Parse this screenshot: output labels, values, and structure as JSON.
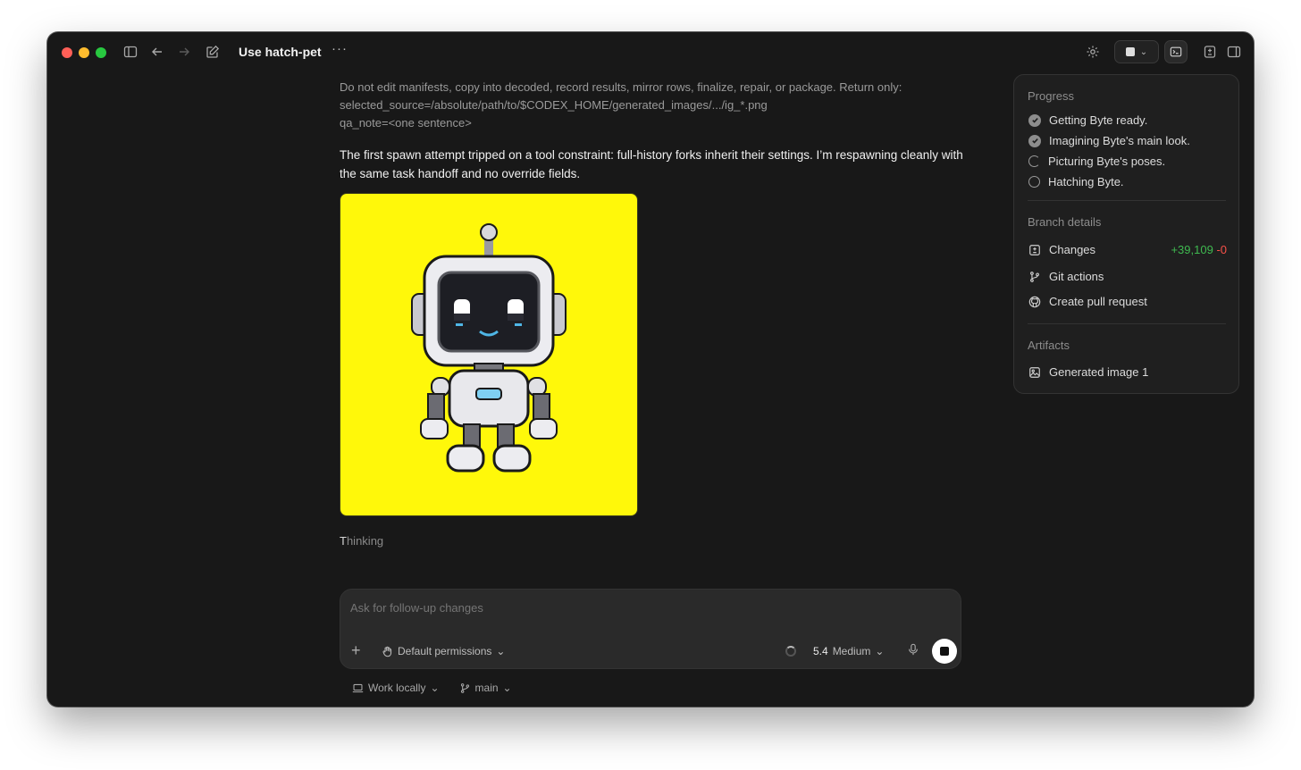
{
  "titlebar": {
    "title": "Use hatch-pet",
    "more_label": "···"
  },
  "messages": {
    "tool_prompt": "Do not edit manifests, copy into decoded, record results, mirror rows, finalize, repair, or package. Return only:\nselected_source=/absolute/path/to/$CODEX_HOME/generated_images/.../ig_*.png\nqa_note=<one sentence>",
    "assistant": "The first spawn attempt tripped on a tool constraint: full-history forks inherit their settings. I’m respawning cleanly with the same task handoff and no override fields.",
    "thinking_first": "T",
    "thinking_rest": "hinking"
  },
  "composer": {
    "placeholder": "Ask for follow-up changes",
    "plus_label": "+",
    "permissions": "Default permissions",
    "model_version": "5.4",
    "model_effort": "Medium"
  },
  "footer": {
    "location": "Work locally",
    "branch": "main"
  },
  "panel": {
    "progress_title": "Progress",
    "progress_items": [
      {
        "label": "Getting Byte ready.",
        "state": "done"
      },
      {
        "label": "Imagining Byte's main look.",
        "state": "done"
      },
      {
        "label": "Picturing Byte's poses.",
        "state": "in-progress"
      },
      {
        "label": "Hatching Byte.",
        "state": "pending"
      }
    ],
    "branch_title": "Branch details",
    "changes_label": "Changes",
    "additions": "+39,109",
    "deletions": "-0",
    "git_actions": "Git actions",
    "pull_request": "Create pull request",
    "artifacts_title": "Artifacts",
    "artifact_item": "Generated image 1"
  },
  "colors": {
    "window_bg": "#181818",
    "image_bg": "#fff80a",
    "additions": "#3fb950",
    "deletions": "#f85149"
  }
}
